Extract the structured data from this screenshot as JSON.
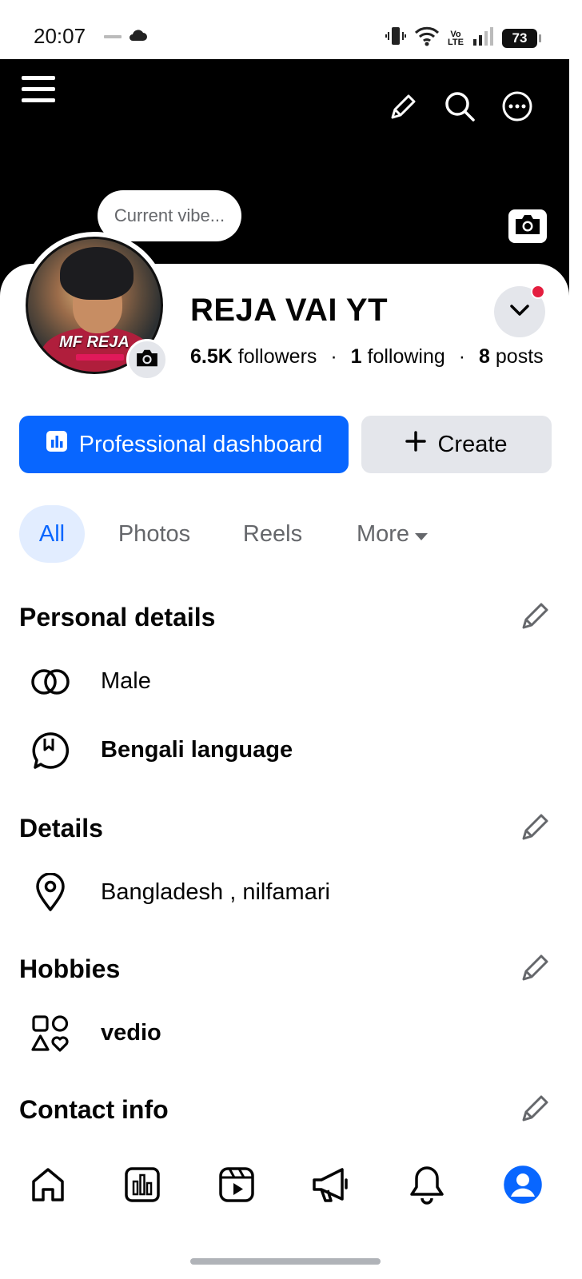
{
  "status_bar": {
    "time": "20:07",
    "battery": "73",
    "network": "Vo\nLTE",
    "icons": [
      "notification-icon",
      "cloud-icon",
      "vibrate-icon",
      "wifi-icon",
      "volte-icon",
      "signal-icon",
      "battery-icon"
    ]
  },
  "cover": {
    "icons": [
      "menu-icon",
      "pencil-icon",
      "search-icon",
      "more-icon",
      "camera-icon"
    ]
  },
  "profile": {
    "vibe_placeholder": "Current vibe...",
    "avatar_text": "MF REJA",
    "name": "REJA VAI YT",
    "followers_count": "6.5K",
    "followers_label": "followers",
    "following_count": "1",
    "following_label": "following",
    "posts_count": "8",
    "posts_label": "posts",
    "separator": "·"
  },
  "actions": {
    "professional_dashboard": "Professional dashboard",
    "create": "Create"
  },
  "tabs": [
    {
      "label": "All",
      "active": true
    },
    {
      "label": "Photos",
      "active": false
    },
    {
      "label": "Reels",
      "active": false
    },
    {
      "label": "More",
      "active": false
    }
  ],
  "sections": {
    "personal_details": {
      "title": "Personal details",
      "gender": "Male",
      "language": "Bengali language"
    },
    "details": {
      "title": "Details",
      "location": "Bangladesh , nilfamari"
    },
    "hobbies": {
      "title": "Hobbies",
      "hobby": "vedio"
    },
    "contact_info": {
      "title": "Contact info"
    }
  },
  "bottom_nav": [
    "home-icon",
    "dashboard-icon",
    "reels-icon",
    "megaphone-icon",
    "bell-icon",
    "profile-icon"
  ],
  "colors": {
    "primary": "#0866ff",
    "active_tab_bg": "#e2edff",
    "secondary_button": "#e4e6eb",
    "notification_dot": "#e41e3f",
    "secondary_text": "#65676b"
  }
}
